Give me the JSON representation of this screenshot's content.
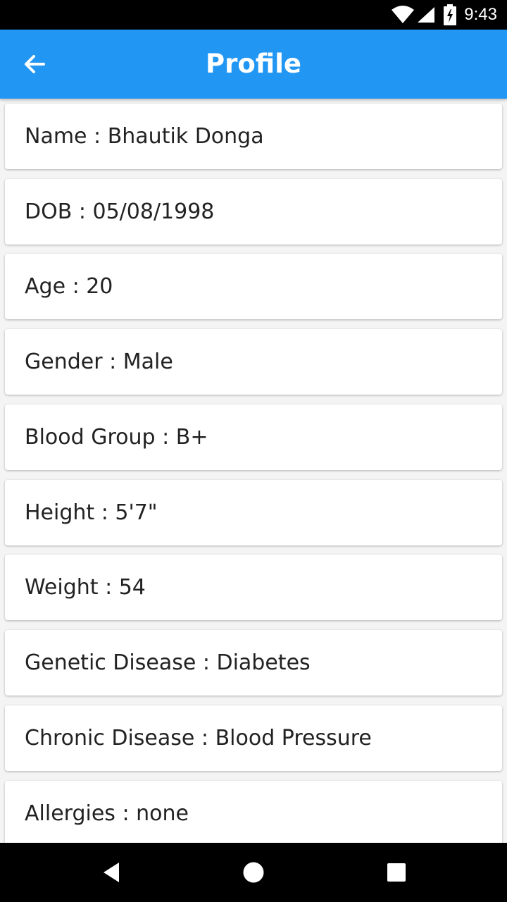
{
  "status_bar": {
    "time": "9:43",
    "icons": [
      "wifi-icon",
      "cell-signal-icon",
      "battery-charging-icon"
    ]
  },
  "app_bar": {
    "title": "Profile",
    "back_icon": "arrow-left-icon",
    "color": "#2196F3"
  },
  "profile": {
    "fields": [
      {
        "label": "Name",
        "value": "Bhautik Donga"
      },
      {
        "label": "DOB",
        "value": "05/08/1998"
      },
      {
        "label": "Age",
        "value": "20"
      },
      {
        "label": "Gender",
        "value": "Male"
      },
      {
        "label": "Blood Group",
        "value": "B+"
      },
      {
        "label": "Height",
        "value": "5'7\""
      },
      {
        "label": "Weight",
        "value": "54"
      },
      {
        "label": "Genetic Disease",
        "value": "Diabetes"
      },
      {
        "label": "Chronic Disease",
        "value": "Blood Pressure"
      },
      {
        "label": "Allergies",
        "value": "none"
      }
    ],
    "separator": " : "
  },
  "nav_bar": {
    "icons": [
      "back-triangle-icon",
      "home-circle-icon",
      "recents-square-icon"
    ]
  }
}
